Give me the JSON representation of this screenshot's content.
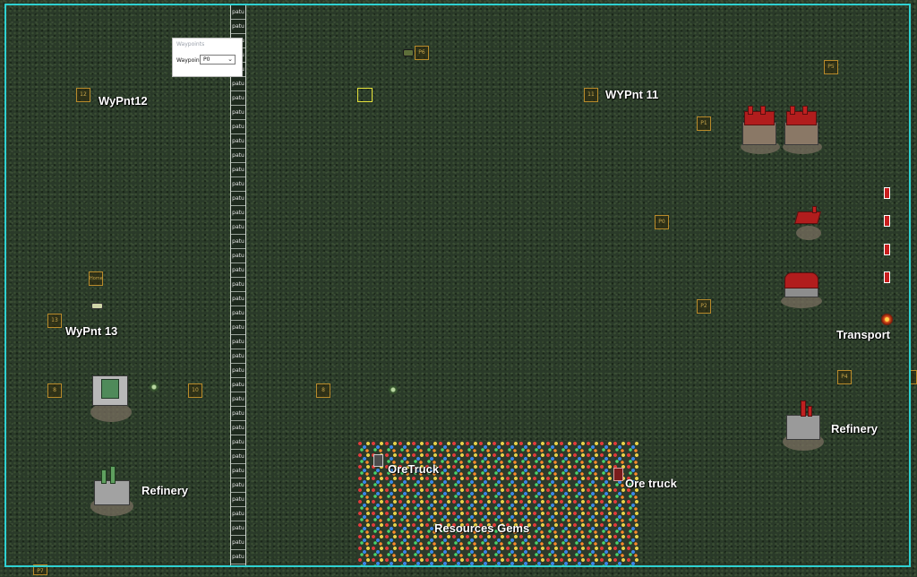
{
  "map": {
    "patu_label": "patu",
    "patu_count": 39,
    "border_color": "#2fd1d1"
  },
  "dialog": {
    "title": "Waypoints",
    "label": "Waypoint",
    "selected": "P0"
  },
  "waypoints": {
    "wp12": "12",
    "wp11": "11",
    "wp13": "13",
    "wp8a": "8",
    "wp10": "10",
    "wp8b": "8",
    "p6": "P6",
    "p5": "P5",
    "p1": "P1",
    "p0": "P0",
    "p2": "P2",
    "p4": "P4",
    "p7": "P7",
    "home": "Home"
  },
  "labels": {
    "wypnt12": "WyPnt12",
    "wypnt11": "WYPnt 11",
    "wypnt13": "WyPnt 13",
    "transport": "Transport",
    "refinery_right": "Refinery",
    "refinery_left": "Refinery",
    "oretruck_left": "OreTruck",
    "oretruck_right": "Ore truck",
    "gems": "Resources Gems"
  }
}
